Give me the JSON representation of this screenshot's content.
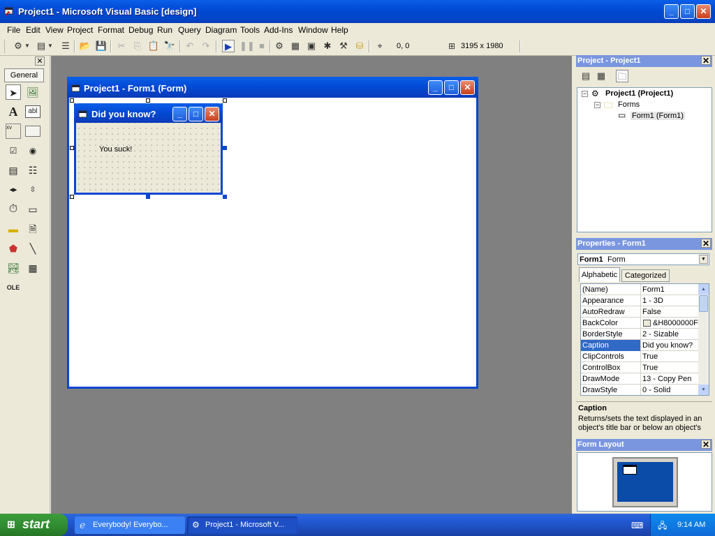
{
  "app": {
    "title": "Project1 - Microsoft Visual Basic [design]",
    "window_buttons": {
      "min": "_",
      "max": "□",
      "close": "✕"
    }
  },
  "menu": [
    "File",
    "Edit",
    "View",
    "Project",
    "Format",
    "Debug",
    "Run",
    "Query",
    "Diagram",
    "Tools",
    "Add-Ins",
    "Window",
    "Help"
  ],
  "toolbar": {
    "position": "0, 0",
    "size": "3195 x 1980"
  },
  "toolbox": {
    "tab": "General",
    "label_tool": "A",
    "textbox_tool": "abl",
    "frame_tool": "xv"
  },
  "project_window": {
    "title": "Project1 - Form1 (Form)"
  },
  "form": {
    "caption": "Did you know?",
    "label": "You suck!"
  },
  "project_explorer": {
    "title": "Project - Project1",
    "root": "Project1 (Project1)",
    "folder": "Forms",
    "item": "Form1 (Form1)"
  },
  "properties": {
    "title": "Properties - Form1",
    "object_name": "Form1",
    "object_type": "Form",
    "tabs": [
      "Alphabetic",
      "Categorized"
    ],
    "rows": [
      {
        "name": "(Name)",
        "value": "Form1"
      },
      {
        "name": "Appearance",
        "value": "1 - 3D"
      },
      {
        "name": "AutoRedraw",
        "value": "False"
      },
      {
        "name": "BackColor",
        "value": "&H8000000F"
      },
      {
        "name": "BorderStyle",
        "value": "2 - Sizable"
      },
      {
        "name": "Caption",
        "value": "Did you know?"
      },
      {
        "name": "ClipControls",
        "value": "True"
      },
      {
        "name": "ControlBox",
        "value": "True"
      },
      {
        "name": "DrawMode",
        "value": "13 - Copy Pen"
      },
      {
        "name": "DrawStyle",
        "value": "0 - Solid"
      }
    ],
    "selected_row": 5,
    "desc_title": "Caption",
    "desc_text": "Returns/sets the text displayed in an object's title bar or below an object's"
  },
  "form_layout": {
    "title": "Form Layout"
  },
  "taskbar": {
    "start": "start",
    "tasks": [
      "Everybody! Everybo...",
      "Project1 - Microsoft V..."
    ],
    "clock": "9:14 AM"
  },
  "colors": {
    "xp_blue": "#0a46d0",
    "selection": "#316ac5",
    "workspace": "#808080",
    "panel_header": "#7a96df"
  }
}
